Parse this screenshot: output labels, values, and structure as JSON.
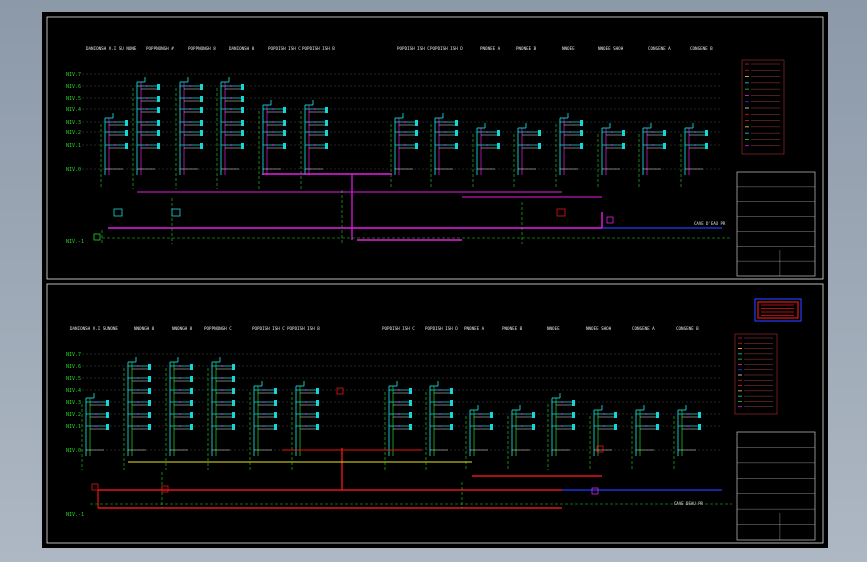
{
  "top": {
    "headers": [
      "DANIONSH V.I SU NONE",
      "POPPNONGH #",
      "POPPNONGH 8",
      "DANIONSH 8",
      "POPDISH ISH C",
      "POPDISH ISH B",
      "POPDISH ISH C",
      "POPDISH ISH D",
      "PNONEE A",
      "PNONEE B",
      "NNOEE",
      "NNOEE SHOH",
      "CONGENE A",
      "CONGENE B"
    ],
    "levels": [
      "NIV.7",
      "NIV.6",
      "NIV.5",
      "NIV.4",
      "NIV.3",
      "NIV.2",
      "NIV.1",
      "NIV.0",
      "NIV.-1"
    ],
    "pipe_label": "CAVE D'EAU PR"
  },
  "bottom": {
    "headers": [
      "DANIONSH V.I SUNONE",
      "NNONGH 8",
      "NNONGH 8",
      "POPPNONGH C",
      "POPDISH ISH C",
      "POPDISH ISH B",
      "POPDISH ISH C",
      "POPDISH ISH D",
      "PNONEE A",
      "PNONEE B",
      "NNOEE",
      "NNOEE SHOH",
      "CONGENE A",
      "CONGENE B"
    ],
    "levels": [
      "NIV.7",
      "NIV.6",
      "NIV.5",
      "NIV.4",
      "NIV.3",
      "NIV.2",
      "NIV.1",
      "NIV.0",
      "NIV.-1"
    ],
    "pipe_label": "CAVE DEAU PR"
  },
  "colors": {
    "cyan": "#18d6d6",
    "green": "#22d622",
    "magenta": "#e61ee6",
    "blue": "#1e3cff",
    "red": "#e61414",
    "yellow": "#e6e61e",
    "white": "#e8e8e8"
  }
}
